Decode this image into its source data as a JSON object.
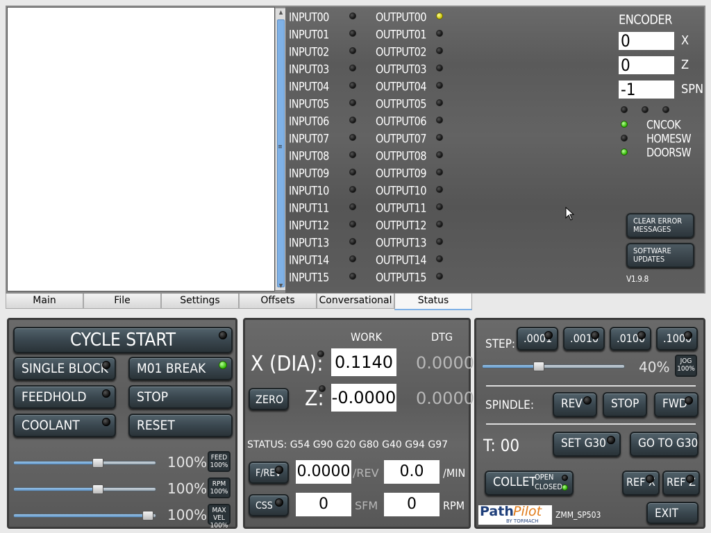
{
  "io": {
    "inputs": [
      {
        "label": "INPUT00",
        "led": "off"
      },
      {
        "label": "INPUT01",
        "led": "off"
      },
      {
        "label": "INPUT02",
        "led": "off"
      },
      {
        "label": "INPUT03",
        "led": "off"
      },
      {
        "label": "INPUT04",
        "led": "off"
      },
      {
        "label": "INPUT05",
        "led": "off"
      },
      {
        "label": "INPUT06",
        "led": "off"
      },
      {
        "label": "INPUT07",
        "led": "off"
      },
      {
        "label": "INPUT08",
        "led": "off"
      },
      {
        "label": "INPUT09",
        "led": "off"
      },
      {
        "label": "INPUT10",
        "led": "off"
      },
      {
        "label": "INPUT11",
        "led": "off"
      },
      {
        "label": "INPUT12",
        "led": "off"
      },
      {
        "label": "INPUT13",
        "led": "off"
      },
      {
        "label": "INPUT14",
        "led": "off"
      },
      {
        "label": "INPUT15",
        "led": "off"
      }
    ],
    "outputs": [
      {
        "label": "OUTPUT00",
        "led": "yellow"
      },
      {
        "label": "OUTPUT01",
        "led": "off"
      },
      {
        "label": "OUTPUT02",
        "led": "off"
      },
      {
        "label": "OUTPUT03",
        "led": "off"
      },
      {
        "label": "OUTPUT04",
        "led": "off"
      },
      {
        "label": "OUTPUT05",
        "led": "off"
      },
      {
        "label": "OUTPUT06",
        "led": "off"
      },
      {
        "label": "OUTPUT07",
        "led": "off"
      },
      {
        "label": "OUTPUT08",
        "led": "off"
      },
      {
        "label": "OUTPUT09",
        "led": "off"
      },
      {
        "label": "OUTPUT10",
        "led": "off"
      },
      {
        "label": "OUTPUT11",
        "led": "off"
      },
      {
        "label": "OUTPUT12",
        "led": "off"
      },
      {
        "label": "OUTPUT13",
        "led": "off"
      },
      {
        "label": "OUTPUT14",
        "led": "off"
      },
      {
        "label": "OUTPUT15",
        "led": "off"
      }
    ]
  },
  "encoder": {
    "title": "ENCODER",
    "fields": [
      {
        "value": "0",
        "axis": "X"
      },
      {
        "value": "0",
        "axis": "Z"
      },
      {
        "value": "-1",
        "axis": "SPN"
      }
    ],
    "top_leds": [
      "off",
      "off",
      "off"
    ],
    "signals": [
      {
        "label": "CNCOK",
        "led": "green"
      },
      {
        "label": "HOMESW",
        "led": "off"
      },
      {
        "label": "DOORSW",
        "led": "green"
      }
    ]
  },
  "status_buttons": {
    "clear_errors": "CLEAR ERROR MESSAGES",
    "software_updates": "SOFTWARE UPDATES",
    "version": "V1.9.8"
  },
  "tabs": [
    "Main",
    "File",
    "Settings",
    "Offsets",
    "Conversational",
    "Status"
  ],
  "active_tab": "Status",
  "left_panel": {
    "cycle_start": "CYCLE START",
    "single_block": "SINGLE BLOCK",
    "m01_break": "M01 BREAK",
    "feedhold": "FEEDHOLD",
    "stop": "STOP",
    "coolant": "COOLANT",
    "reset": "RESET",
    "overrides": [
      {
        "pct": "100%",
        "badge": "FEED 100%",
        "level": 0.6
      },
      {
        "pct": "100%",
        "badge": "RPM 100%",
        "level": 0.6
      },
      {
        "pct": "100%",
        "badge": "MAX VEL 100%",
        "level": 0.95
      }
    ]
  },
  "dro_panel": {
    "work_header": "WORK",
    "dtg_header": "DTG",
    "x_label": "X (DIA):",
    "x_work": "0.1140",
    "x_dtg": "0.0000",
    "z_label": "Z:",
    "z_work": "-0.0000",
    "z_dtg": "0.0000",
    "zero_button": "ZERO",
    "status_line": "STATUS: G54 G90 G20 G80 G40 G94 G97",
    "f_rev_button": "F/REV",
    "feed_rev_value": "0.0000",
    "feed_rev_unit": "/REV",
    "feed_min_value": "0.0",
    "feed_min_unit": "/MIN",
    "css_button": "CSS",
    "sfm_value": "0",
    "sfm_unit": "SFM",
    "rpm_value": "0",
    "rpm_unit": "RPM"
  },
  "right_panel": {
    "step_label": "STEP:",
    "steps": [
      ".0001",
      ".0010",
      ".0100",
      ".1000"
    ],
    "jog_pct": "40%",
    "jog_level": 0.4,
    "jog_badge": "JOG 100%",
    "spindle_label": "SPINDLE:",
    "rev": "REV",
    "stop": "STOP",
    "fwd": "FWD",
    "tool_label": "T: 00",
    "set_g30": "SET G30",
    "go_to_g30": "GO TO G30",
    "collet_label": "COLLET",
    "collet_open": "OPEN",
    "collet_closed": "CLOSED",
    "ref_x": "REF X",
    "ref_z": "REF Z",
    "logo_path": "Path",
    "logo_pilot": "Pilot",
    "logo_sub": "BY TORMACH",
    "machine_id": "ZMM_SP503",
    "exit": "EXIT"
  }
}
